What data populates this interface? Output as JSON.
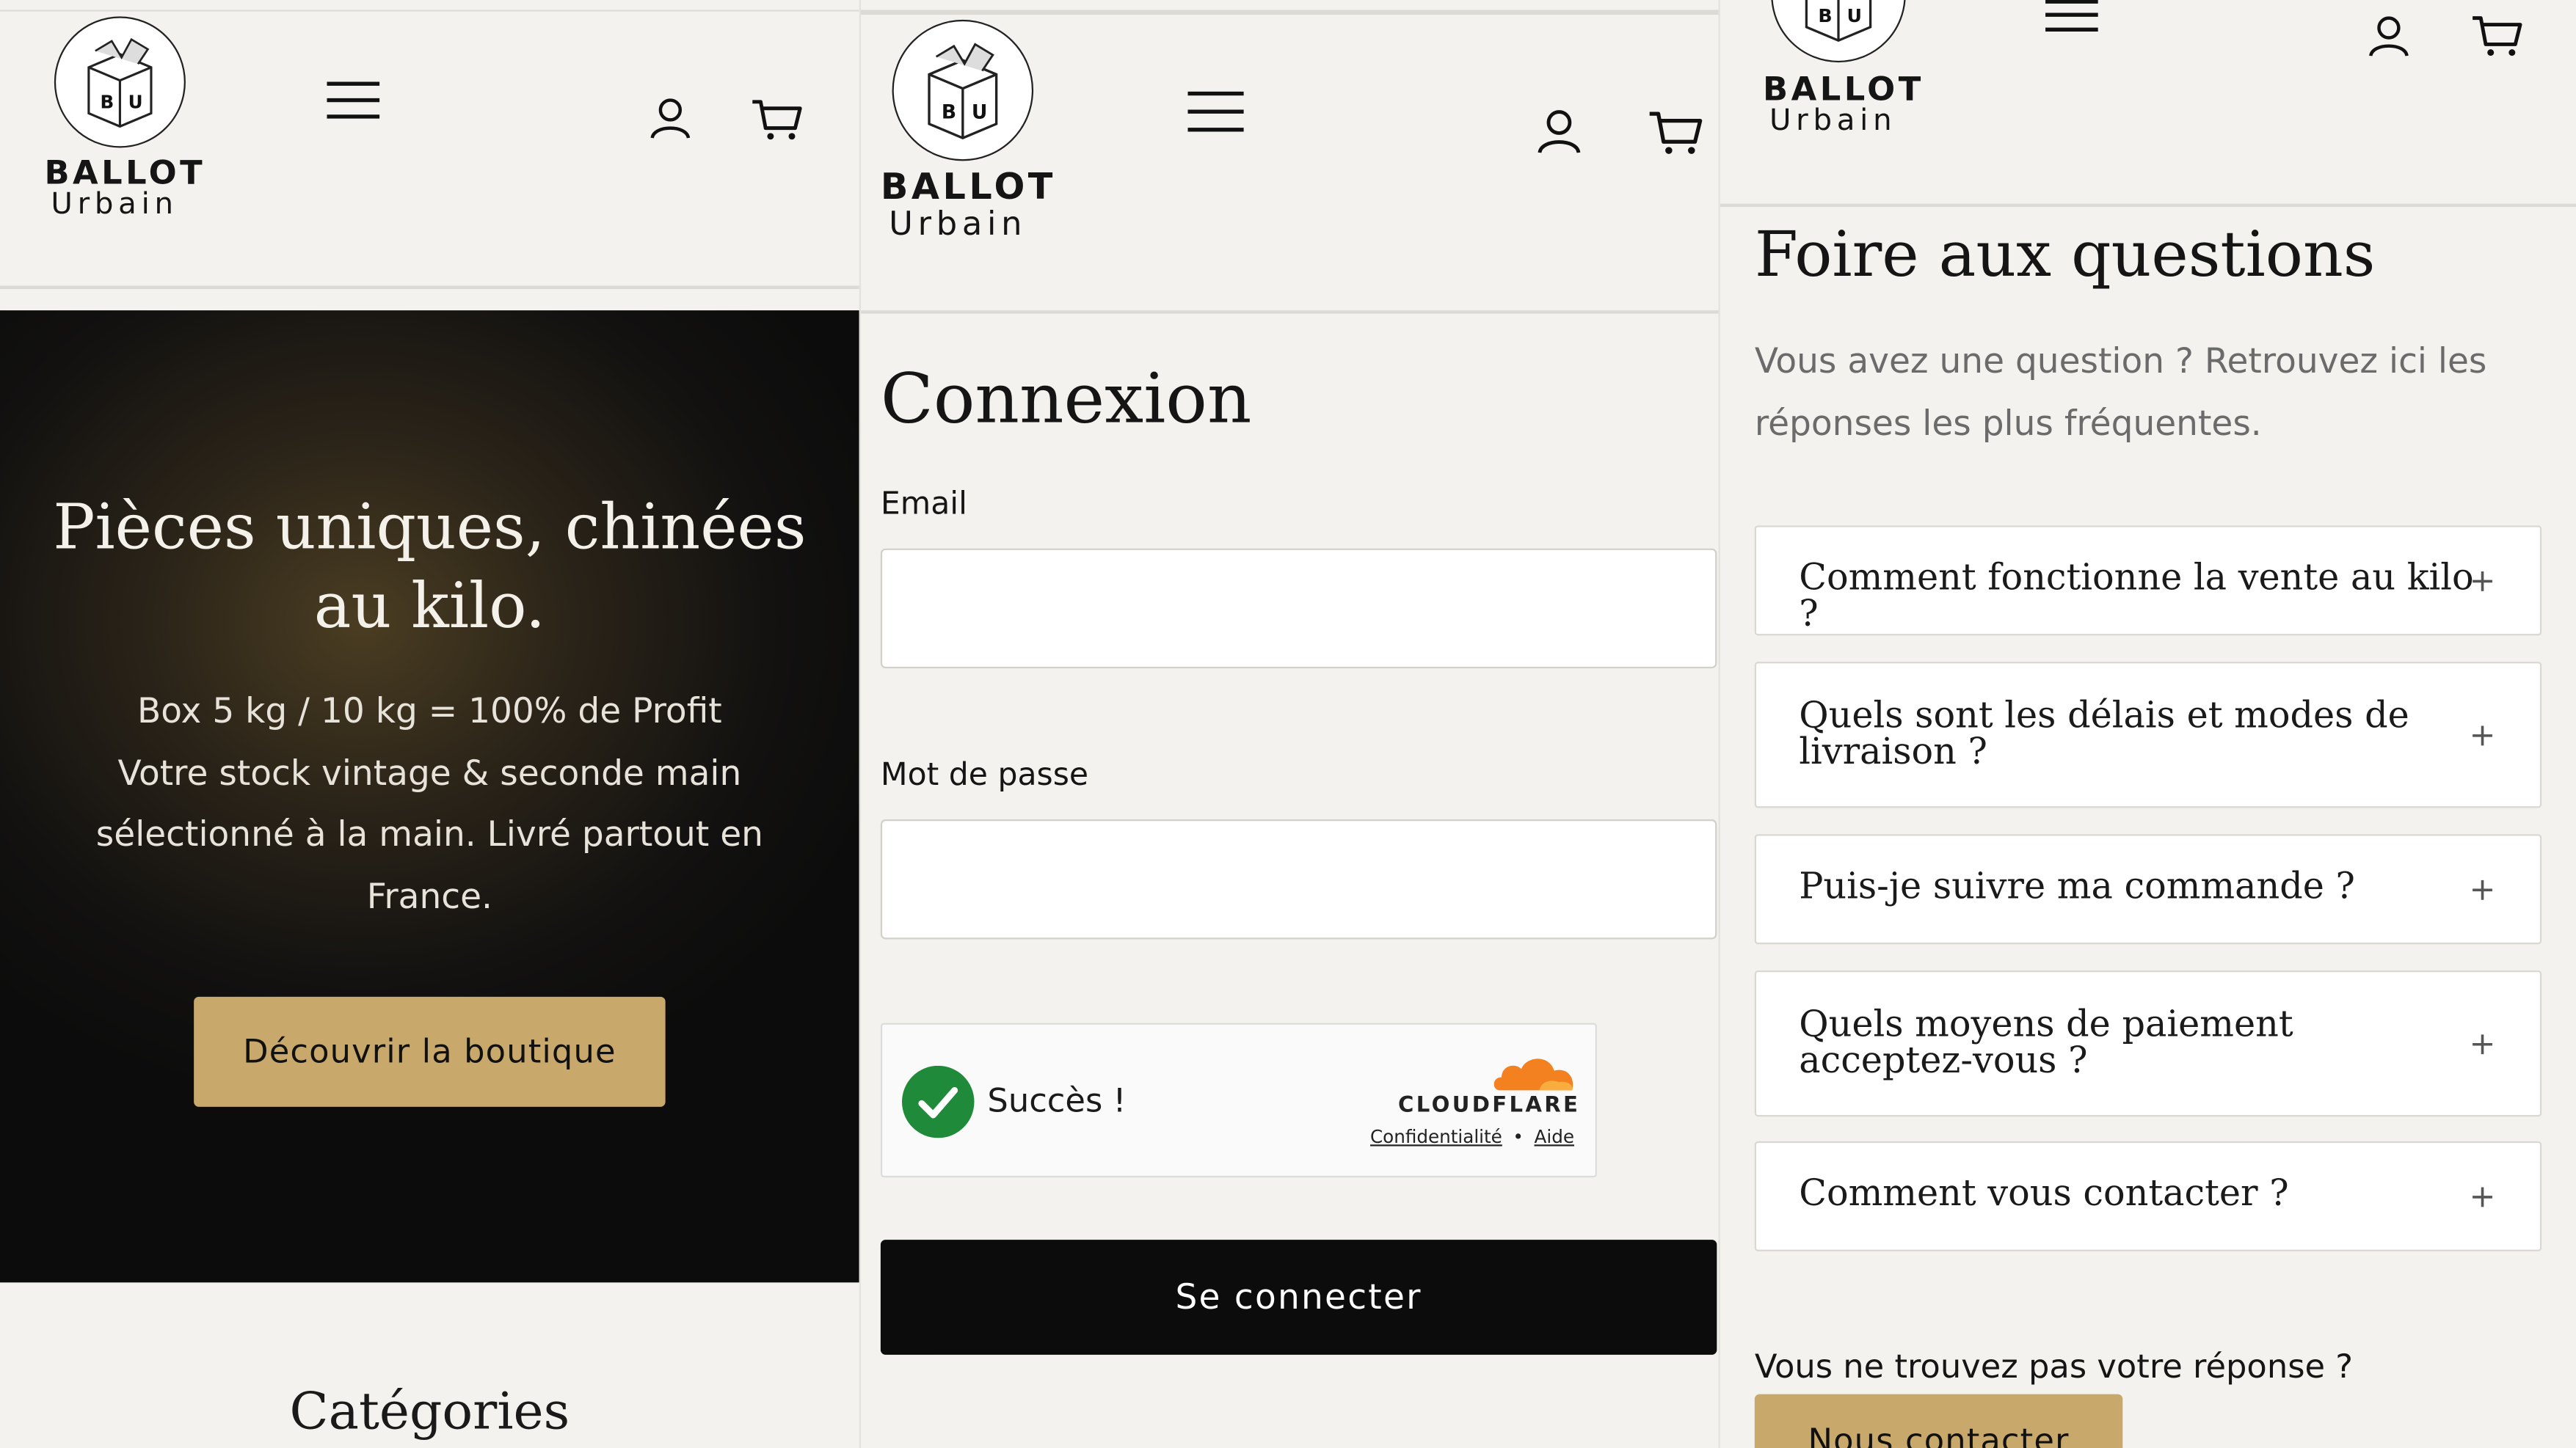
{
  "brand": {
    "line1": "BALLOT",
    "line2": "Urbain",
    "badge_letters": "B U"
  },
  "colors": {
    "gold": "#c8a96b",
    "dark": "#0c0c0c",
    "background": "#f3f2ee",
    "cloudflare_orange": "#f48120",
    "success_green": "#1f8b3a"
  },
  "panel1": {
    "hero": {
      "title": "Pièces uniques, chinées au kilo.",
      "line1": "Box 5 kg / 10 kg = 100% de Profit",
      "line2": "Votre stock vintage & seconde main sélectionné à la main. Livré partout en France.",
      "cta": "Découvrir la boutique"
    },
    "categories_title": "Catégories"
  },
  "panel2": {
    "title": "Connexion",
    "email_label": "Email",
    "password_label": "Mot de passe",
    "captcha": {
      "status": "Succès !",
      "brand": "CLOUDFLARE",
      "privacy": "Confidentialité",
      "separator": "•",
      "help": "Aide"
    },
    "submit": "Se connecter"
  },
  "panel3": {
    "title": "Foire aux questions",
    "intro": "Vous avez une question ? Retrouvez ici les réponses les plus fréquentes.",
    "questions": [
      "Comment fonctionne la vente au kilo ?",
      "Quels sont les délais et modes de livraison ?",
      "Puis-je suivre ma commande ?",
      "Quels moyens de paiement acceptez-vous ?",
      "Comment vous contacter ?"
    ],
    "not_found": "Vous ne trouvez pas votre réponse ?",
    "contact_button": "Nous contacter"
  },
  "icons": [
    "menu-icon",
    "account-icon",
    "cart-icon",
    "plus-icon",
    "checkmark-icon",
    "cloudflare-cloud-icon"
  ]
}
